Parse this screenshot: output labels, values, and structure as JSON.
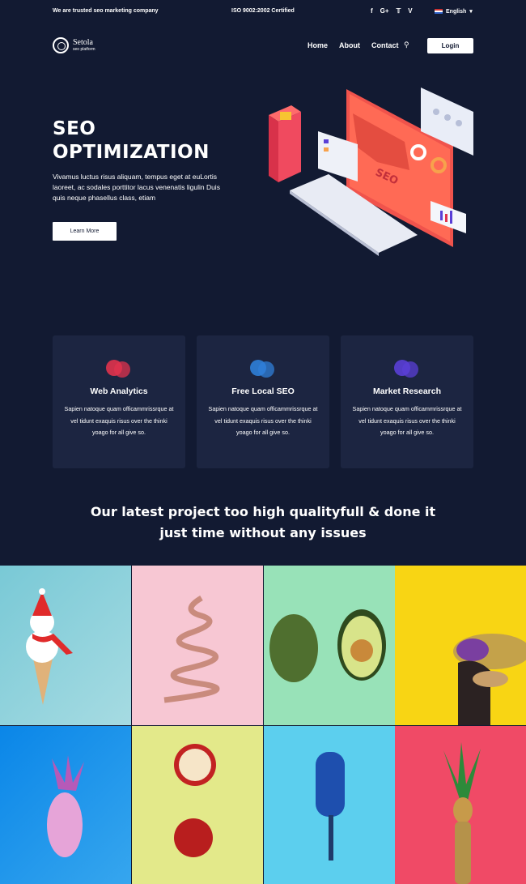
{
  "topbar": {
    "trust": "We are trusted seo marketing company",
    "iso": "ISO 9002:2002 Certified",
    "social": [
      "f",
      "G+",
      "𝕋",
      "V"
    ],
    "language": "English"
  },
  "nav": {
    "brand": "Setola",
    "brand_sub": "seo platform",
    "links": [
      "Home",
      "About",
      "Contact"
    ],
    "login": "Login"
  },
  "hero": {
    "title1": "SEO",
    "title2": "OPTIMIZATION",
    "text": "Vivamus luctus risus aliquam, tempus eget at euLortis laoreet, ac sodales porttitor lacus venenatis ligulin Duis quis neque phasellus class, etiam",
    "button": "Learn More",
    "screen_label": "SEO"
  },
  "features": [
    {
      "title": "Web Analytics",
      "text": "Sapien natoque quam officammrissrque at vel tidunt exaquis risus over the thinki yoago for all give so.",
      "color": "#e0334d"
    },
    {
      "title": "Free Local SEO",
      "text": "Sapien natoque quam officammrissrque at vel tidunt exaquis risus over the thinki yoago for all give so.",
      "color": "#2f7fd8"
    },
    {
      "title": "Market Research",
      "text": "Sapien natoque quam officammrissrque at vel tidunt exaquis risus over the thinki yoago for all give so.",
      "color": "#5a3fd6"
    }
  ],
  "section": {
    "line1": "Our latest project too high qualityfull & done it",
    "line2": "just time without any issues"
  },
  "colors": {
    "bg": "#121a32",
    "card": "#1c2541",
    "accent": "#f0534c"
  }
}
